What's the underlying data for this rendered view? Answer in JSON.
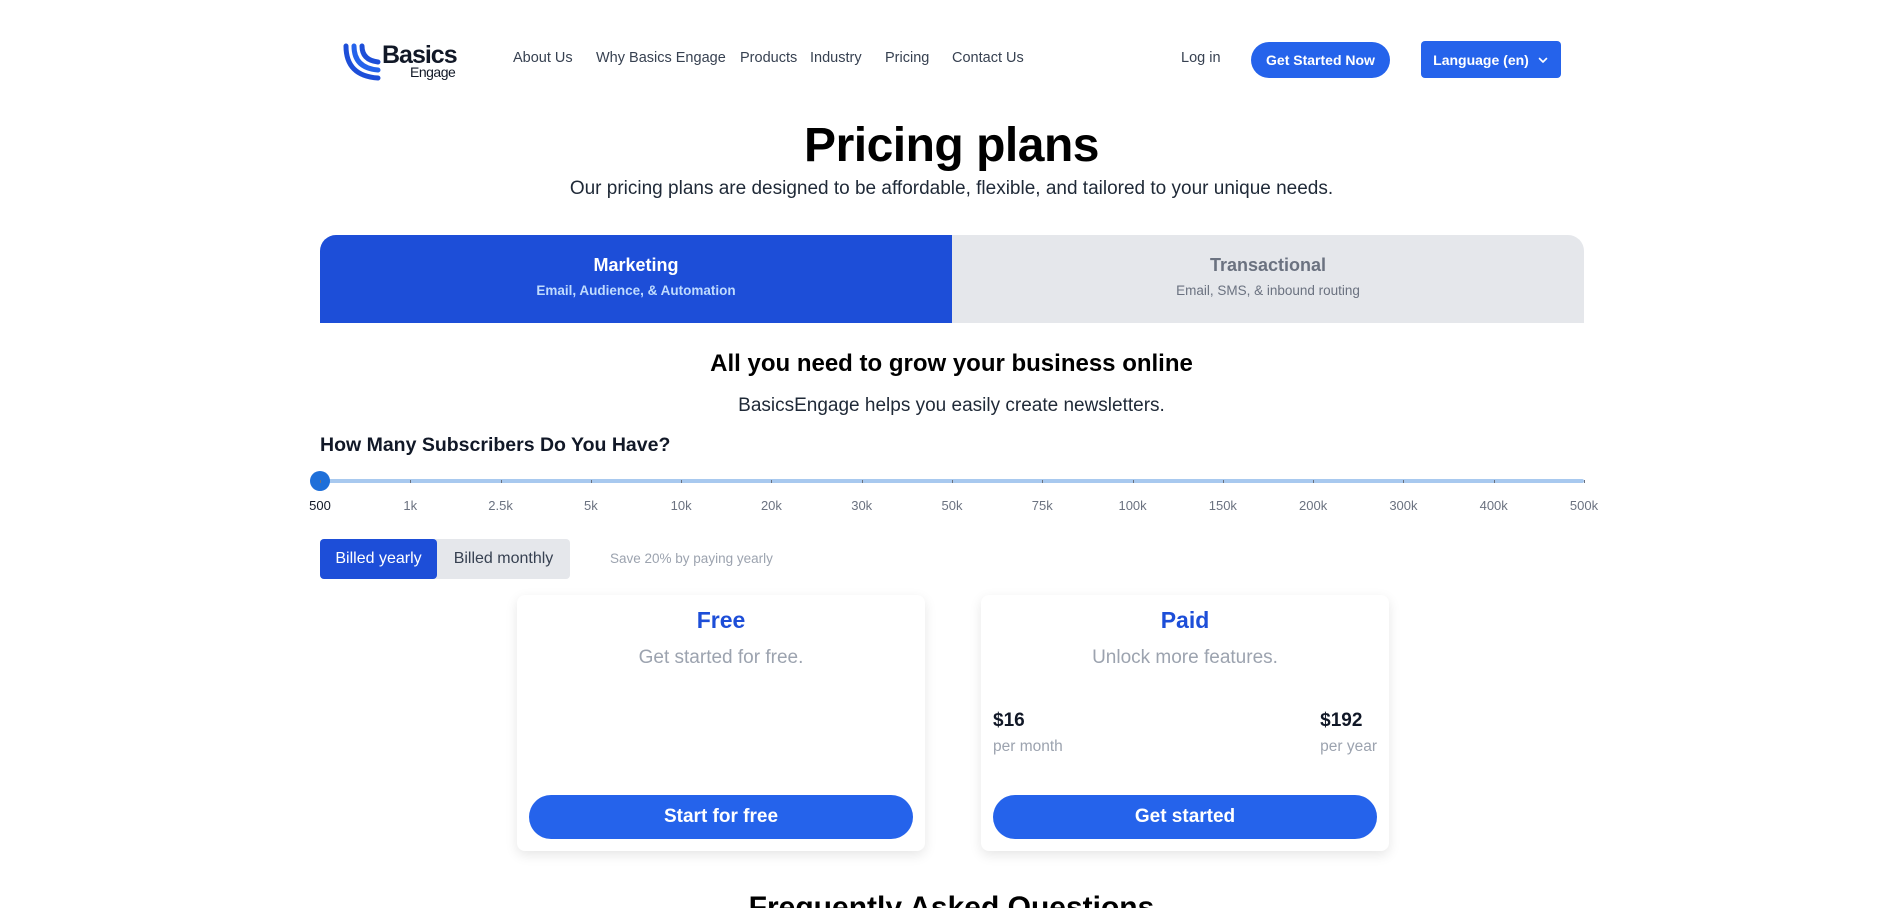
{
  "brand": {
    "name_line1": "Basics",
    "name_line2": "Engage",
    "accent": "#2563eb"
  },
  "nav": [
    {
      "label": "About Us"
    },
    {
      "label": "Why Basics Engage"
    },
    {
      "label": "Products"
    },
    {
      "label": "Industry"
    },
    {
      "label": "Pricing"
    },
    {
      "label": "Contact Us"
    }
  ],
  "header": {
    "login_label": "Log in",
    "cta_label": "Get Started Now",
    "language_label": "Language (en)",
    "language_icon": "chevron-down-icon"
  },
  "hero": {
    "title": "Pricing plans",
    "subtitle": "Our pricing plans are designed to be affordable, flexible, and tailored to your unique needs."
  },
  "tabs": [
    {
      "title": "Marketing",
      "subtitle": "Email, Audience, & Automation",
      "active": true
    },
    {
      "title": "Transactional",
      "subtitle": "Email, SMS, & inbound routing",
      "active": false
    }
  ],
  "section": {
    "heading": "All you need to grow your business online",
    "subtitle": "BasicsEngage helps you easily create newsletters."
  },
  "slider": {
    "question": "How Many Subscribers Do You Have?",
    "labels": [
      "500",
      "1k",
      "2.5k",
      "5k",
      "10k",
      "20k",
      "30k",
      "50k",
      "75k",
      "100k",
      "150k",
      "200k",
      "300k",
      "400k",
      "500k"
    ],
    "selected_index": 0
  },
  "billing": {
    "yearly_label": "Billed yearly",
    "monthly_label": "Billed monthly",
    "selected": "yearly",
    "save_note": "Save 20% by paying yearly"
  },
  "plans": {
    "free": {
      "name": "Free",
      "description": "Get started for free.",
      "button_label": "Start for free"
    },
    "paid": {
      "name": "Paid",
      "description": "Unlock more features.",
      "monthly_price": "$16",
      "monthly_period": "per month",
      "yearly_price": "$192",
      "yearly_period": "per year",
      "button_label": "Get started"
    }
  },
  "faq": {
    "heading": "Frequently Asked Questions"
  }
}
